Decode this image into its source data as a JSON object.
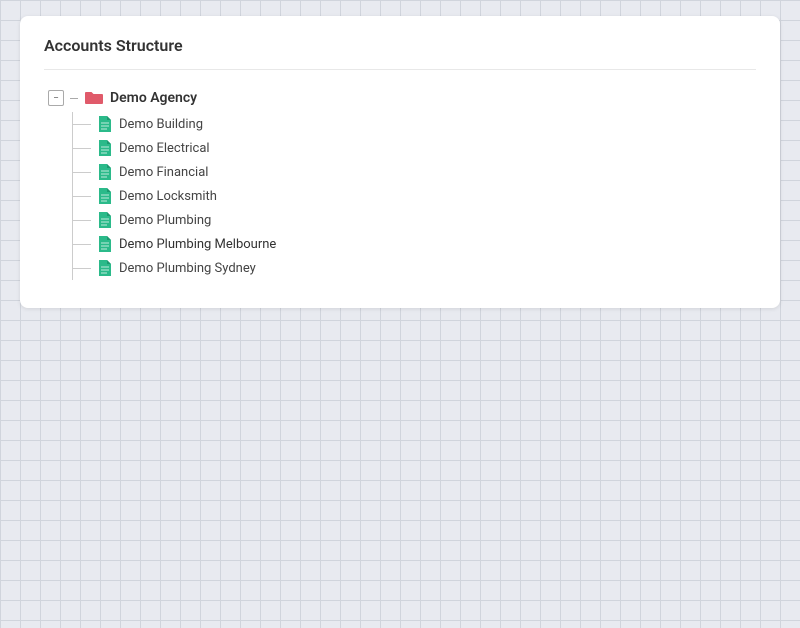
{
  "page": {
    "title": "Accounts Structure"
  },
  "tree": {
    "toggle_symbol": "−",
    "root": {
      "label": "Demo Agency"
    },
    "children": [
      {
        "label": "Demo Building"
      },
      {
        "label": "Demo Electrical"
      },
      {
        "label": "Demo Financial"
      },
      {
        "label": "Demo Locksmith"
      },
      {
        "label": "Demo Plumbing"
      },
      {
        "label": "Demo Plumbing Melbourne",
        "highlighted": true
      },
      {
        "label": "Demo Plumbing Sydney"
      }
    ]
  },
  "colors": {
    "folder": "#e05a6a",
    "doc": "#2bba8a",
    "connector": "#aaaaaa"
  }
}
